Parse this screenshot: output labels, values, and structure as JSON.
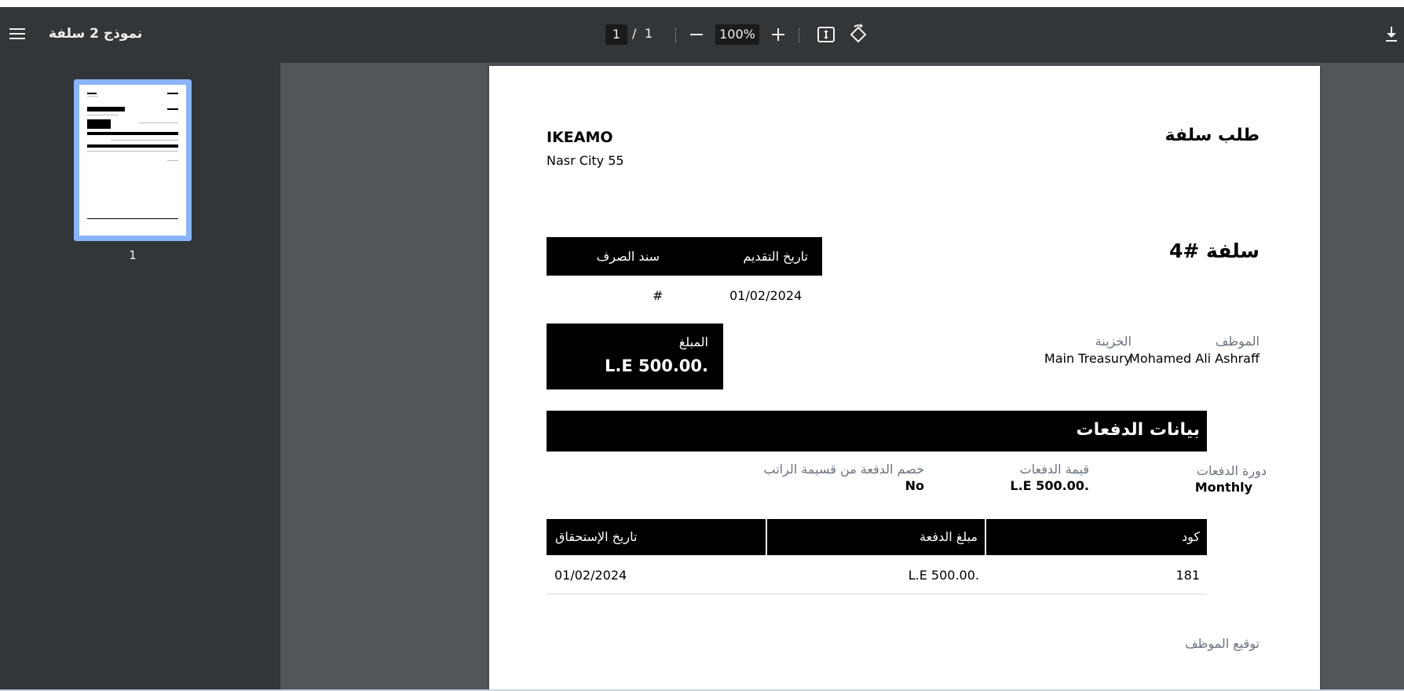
{
  "toolbar": {
    "title": "نموذج 2 سلفة",
    "page_current": "1",
    "page_separator": "/",
    "page_total": "1",
    "zoom": "100%",
    "icons": [
      "menu-icon",
      "zoom-out-icon",
      "zoom-in-icon",
      "fit-page-icon",
      "rotate-icon",
      "download-icon"
    ]
  },
  "sidebar": {
    "thumbnail_label": "1"
  },
  "document": {
    "company": "IKEAMO",
    "address": "Nasr City 55",
    "heading": "طلب سلفة",
    "loan_number": "سلفة #4",
    "header_table": {
      "col_date": "تاريخ التقديم",
      "col_voucher": "سند الصرف",
      "date_value": "01/02/2024",
      "voucher_value": "#"
    },
    "employee_label": "الموظف",
    "employee_value": "Mohamed Ali Ashraff",
    "treasury_label": "الخزينة",
    "treasury_value": "Main Treasury",
    "amount_label": "المبلغ",
    "amount_value": "L.E 500.00.",
    "payments_section_title": "بيانات الدفعات",
    "cycle_label": "دورة الدفعات",
    "cycle_value": "Monthly",
    "payment_value_label": "قيمة الدفعات",
    "payment_value": "L.E 500.00.",
    "deduct_label": "خصم الدفعة من قسيمة الراتب",
    "deduct_value": "No",
    "table": {
      "headers": [
        "كود",
        "مبلغ الدفعة",
        "تاريخ الإستحقاق"
      ],
      "rows": [
        [
          "181",
          "L.E 500.00.",
          "01/02/2024"
        ]
      ]
    },
    "signature_label": "توقيع الموظف"
  },
  "colors": {
    "toolbar_bg": "#323639",
    "viewer_bg": "#525659",
    "thumbnail_highlight": "#8ab4f8",
    "label_gray": "#6b7280"
  }
}
